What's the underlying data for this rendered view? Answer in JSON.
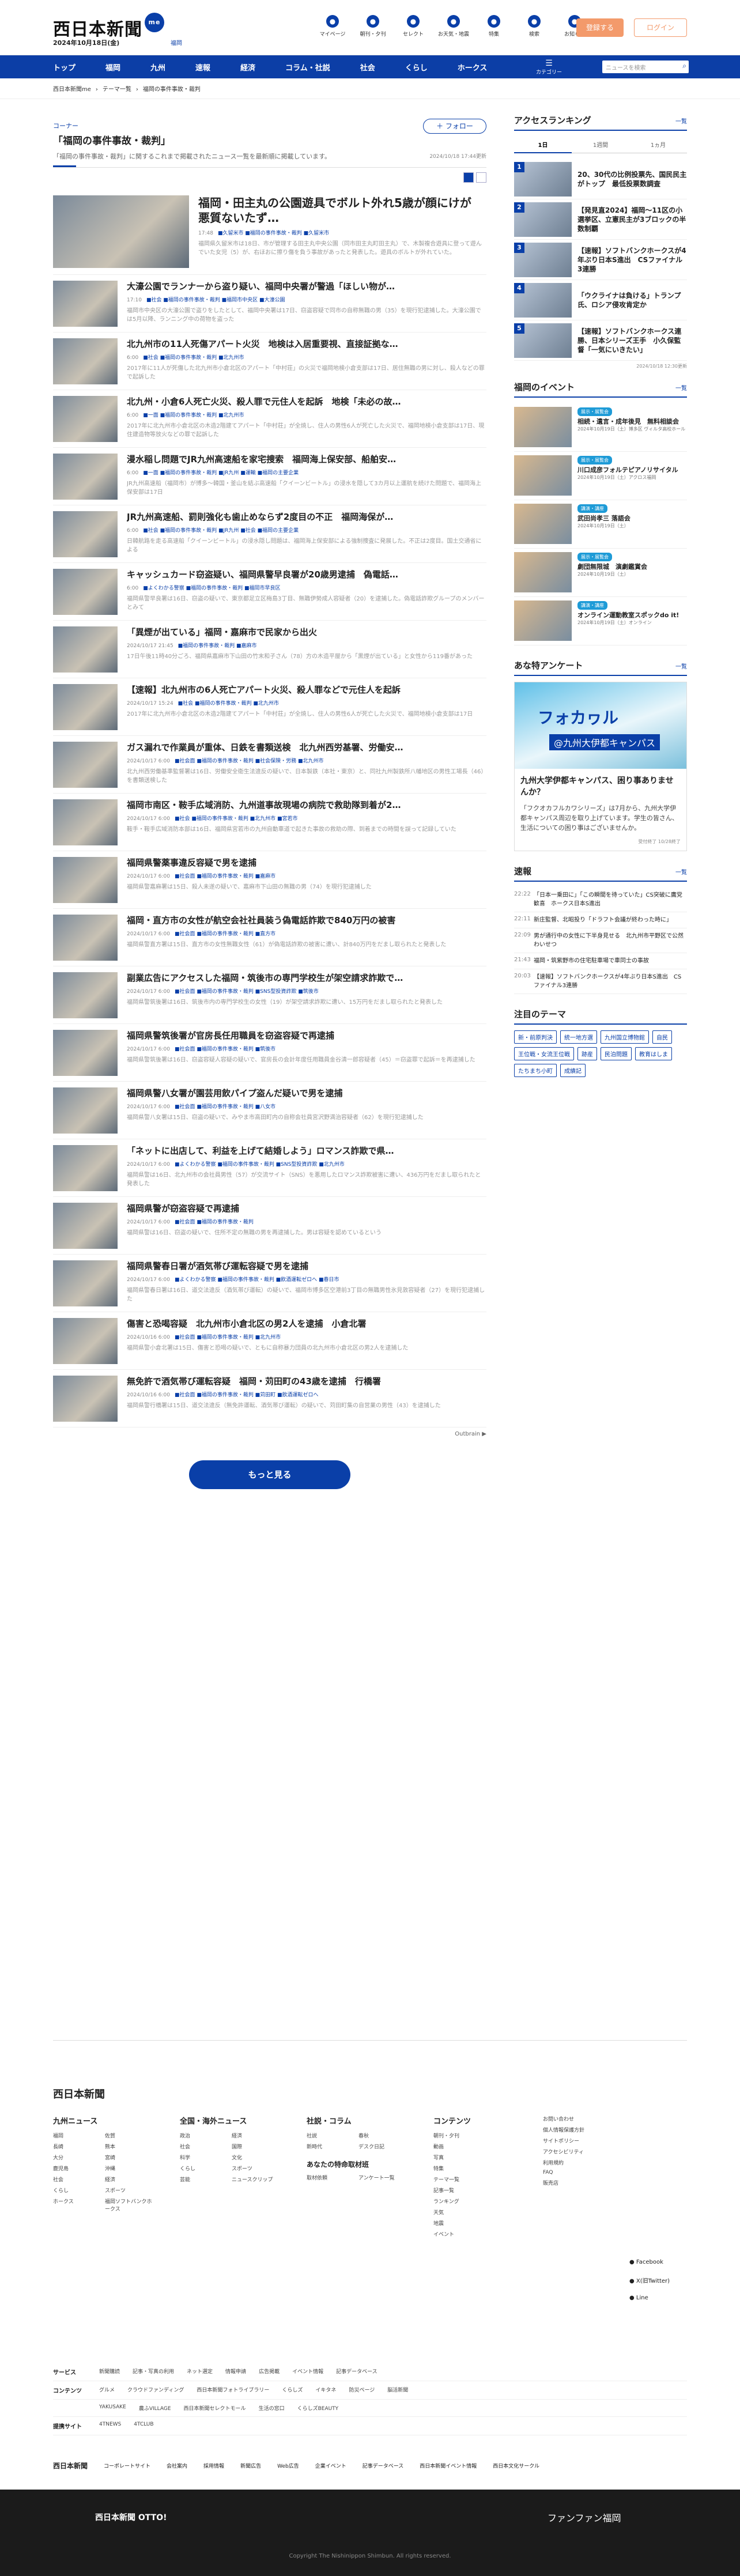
{
  "header": {
    "logo": "西日本新聞",
    "badge": "me",
    "date": "2024年10月18日(金)",
    "area": "福岡",
    "icons": [
      {
        "label": "マイページ",
        "icon": "person-icon"
      },
      {
        "label": "朝刊・夕刊",
        "icon": "paper-icon"
      },
      {
        "label": "セレクト",
        "icon": "select-icon"
      },
      {
        "label": "お天気・地震",
        "icon": "weather-icon"
      },
      {
        "label": "特集",
        "icon": "book-icon"
      },
      {
        "label": "検索",
        "icon": "search-icon"
      },
      {
        "label": "お知らせ",
        "icon": "bell-icon"
      }
    ],
    "register": "登録する",
    "login": "ログイン"
  },
  "nav": {
    "items": [
      "トップ",
      "福岡",
      "九州",
      "速報",
      "経済",
      "コラム・社説",
      "社会",
      "くらし",
      "ホークス"
    ],
    "menu": "カテゴリー",
    "search_placeholder": "ニュースを検索"
  },
  "breadcrumb": [
    "西日本新聞me",
    "テーマ一覧",
    "福岡の事件事故・裁判"
  ],
  "page": {
    "corner": "コーナー",
    "title": "「福岡の事件事故・裁判」",
    "desc": "「福岡の事件事故・裁判」に関するこれまで掲載されたニュース一覧を最新順に掲載しています。",
    "follow": "＋ フォロー",
    "updated": "2024/10/18 17:44更新"
  },
  "articles": [
    {
      "t": "福岡・田主丸の公園遊具でボルト外れ5歳が顔にけが　悪質ないたず…",
      "tm": "17:48",
      "tags": "■久留米市 ■福岡の事件事故・裁判 ■久留米市",
      "ex": "福岡県久留米市は18日、市が管理する田主丸中央公園（同市田主丸町田主丸）で、木製複合遊具に登って遊んでいた女児（5）が、右ほおに擦り傷を負う事故があったと発表した。遊具のボルトが外れていた。"
    },
    {
      "t": "大濠公園でランナーから盗り疑い、福岡中央署が警過「ほしい物が…",
      "tm": "17:10",
      "tags": "■社会 ■福岡の事件事故・裁判 ■福岡市中央区 ■大濠公園",
      "ex": "福岡市中央区の大濠公園で盗りをしたとして、福岡中央署は17日、窃盗容疑で同市の自称無職の男（35）を現行犯逮捕した。大濠公園では5月以降、ランニング中の荷物を盗った"
    },
    {
      "t": "北九州市の11人死傷アパート火災　地検は入居重要視、直接証拠な…",
      "tm": "6:00",
      "tags": "■社会 ■福岡の事件事故・裁判 ■北九州市",
      "ex": "2017年に11人が死傷した北九州市小倉北区のアパート「中村荘」の火災で福岡地検小倉支部は17日、居住無職の男に対し、殺人などの罪で起訴した"
    },
    {
      "t": "北九州・小倉6人死亡火災、殺人罪で元住人を起訴　地検「未必の故…",
      "tm": "6:00",
      "tags": "■一面 ■福岡の事件事故・裁判 ■北九州市",
      "ex": "2017年に北九州市小倉北区の木造2階建てアパート「中村荘」が全焼し、住人の男性6人が死亡した火災で、福岡地検小倉支部は17日、現住建造物等放火などの罪で起訴した"
    },
    {
      "t": "漫水稲し問題でJR九州高速船を家宅捜索　福岡海上保安部、船舶安…",
      "tm": "6:00",
      "tags": "■一面 ■福岡の事件事故・裁判 ■JR九州 ■運輸 ■福岡の主要企業",
      "ex": "JR九州高速船（福岡市）が博多～韓国・釜山を結ぶ高速船「クイーンビートル」の浸水を隠して3カ月以上運航を続けた問題で、福岡海上保安部は17日"
    },
    {
      "t": "JR九州高速船、罰則強化も歯止めならず2度目の不正　福岡海保が…",
      "tm": "6:00",
      "tags": "■社会 ■福岡の事件事故・裁判 ■JR九州 ■社会 ■福岡の主要企業",
      "ex": "日韓航路を走る高速船「クイーンビートル」の浸水隠し問題は、福岡海上保安部による強制捜査に発展した。不正は2度目。国土交通省による"
    },
    {
      "t": "キャッシュカード窃盗疑い、福岡県警早良署が20歳男逮捕　偽電話…",
      "tm": "6:00",
      "tags": "■よくわかる警察 ■福岡の事件事故・裁判 ■福岡市早良区",
      "ex": "福岡県警早良署は16日、窃盗の疑いで、東京都足立区梅島3丁目、無職伊勢成人容疑者（20）を逮捕した。偽電話詐欺グループのメンバーとみて"
    },
    {
      "t": "「異煙が出ている」福岡・嘉麻市で民家から出火",
      "tm": "2024/10/17 21:45",
      "tags": "■福岡の事件事故・裁判 ■嘉麻市",
      "ex": "17日午後11時40分ごろ、福岡県嘉麻市下山田の竹末和子さん（78）方の木造平屋から「黒煙が出ている」と女性から119番があった"
    },
    {
      "t": "【速報】北九州市の6人死亡アパート火災、殺人罪などで元住人を起訴",
      "tm": "2024/10/17 15:24",
      "tags": "■社会 ■福岡の事件事故・裁判 ■北九州市",
      "ex": "2017年に北九州市小倉北区の木造2階建てアパート「中村荘」が全焼し、住人の男性6人が死亡した火災で、福岡地検小倉支部は17日"
    },
    {
      "t": "ガス漏れで作業員が重体、日鉄を書類送検　北九州西労基署、労働安…",
      "tm": "2024/10/17 6:00",
      "tags": "■社会面 ■福岡の事件事故・裁判 ■社会保険・労務 ■北九州市",
      "ex": "北九州西労働基準監督署は16日、労働安全衛生法違反の疑いで、日本製鉄（本社・東京）と、同社九州製鉄所八幡地区の男性工場長（46）を書類送検した"
    },
    {
      "t": "福岡市南区・鞍手広域消防、九州道事故現場の病院で救助隊到着が2…",
      "tm": "2024/10/17 6:00",
      "tags": "■社会 ■福岡の事件事故・裁判 ■北九州市 ■宮若市",
      "ex": "鞍手・鞍手広域消防本部は16日、福岡県宮若市の九州自動車道で起きた事故の救助の際、到着までの時間を誤って記録していた"
    },
    {
      "t": "福岡県警薬事違反容疑で男を逮捕",
      "tm": "2024/10/17 6:00",
      "tags": "■社会面 ■福岡の事件事故・裁判 ■嘉麻市",
      "ex": "福岡県警嘉麻署は15日、殺人未遂の疑いで、嘉麻市下山田の無職の男（74）を現行犯逮捕した"
    },
    {
      "t": "福岡・直方市の女性が航空会社社員装う偽電話詐欺で840万円の被害",
      "tm": "2024/10/17 6:00",
      "tags": "■社会面 ■福岡の事件事故・裁判 ■直方市",
      "ex": "福岡県警直方署は15日、直方市の女性無職女性（61）が偽電話詐欺の被害に遭い、計840万円をだまし取られたと発表した"
    },
    {
      "t": "副業広告にアクセスした福岡・筑後市の専門学校生が架空請求詐欺で…",
      "tm": "2024/10/17 6:00",
      "tags": "■社会面 ■福岡の事件事故・裁判 ■SNS型投資詐欺 ■筑後市",
      "ex": "福岡県警筑後署は16日、筑後市内の専門学校生の女性（19）が架空請求詐欺に遭い、15万円をだまし取られたと発表した"
    },
    {
      "t": "福岡県警筑後署が官房長任用職員を窃盗容疑で再逮捕",
      "tm": "2024/10/17 6:00",
      "tags": "■社会面 ■福岡の事件事故・裁判 ■筑後市",
      "ex": "福岡県警筑後署は16日、窃盗容疑人容疑の疑いで、官房長の会計年度任用職員金谷清一郎容疑者（45）＝窃盗罪で起訴＝を再逮捕した"
    },
    {
      "t": "福岡県警八女署が園芸用飲パイプ盗んだ疑いで男を逮捕",
      "tm": "2024/10/17 6:00",
      "tags": "■社会面 ■福岡の事件事故・裁判 ■八女市",
      "ex": "福岡県警八女署は15日、窃盗の疑いで、みやま市高田町内の自称会社員宮沢野満治容疑者（62）を現行犯逮捕した"
    },
    {
      "t": "「ネットに出店して、利益を上げて結婚しよう」ロマンス詐欺で県…",
      "tm": "2024/10/17 6:00",
      "tags": "■よくわかる警察 ■福岡の事件事故・裁判 ■SNS型投資詐欺 ■北九州市",
      "ex": "福岡県警は16日、北九州市の会社員男性（57）が交流サイト（SNS）を悪用したロマンス詐欺被害に遭い、436万円をだまし取られたと発表した"
    },
    {
      "t": "福岡県警が窃盗容疑で再逮捕",
      "tm": "2024/10/17 6:00",
      "tags": "■社会面 ■福岡の事件事故・裁判",
      "ex": "福岡県警は16日、窃盗の疑いで、住所不定の無職の男を再逮捕した。男は容疑を認めているという"
    },
    {
      "t": "福岡県警春日署が酒気帯び運転容疑で男を逮捕",
      "tm": "2024/10/17 6:00",
      "tags": "■よくわかる警察 ■福岡の事件事故・裁判 ■飲酒運転ゼロへ ■春日市",
      "ex": "福岡県警春日署は16日、道交法違反（酒気帯び運転）の疑いで、福岡市博多区空港前3丁目の無職男性氷見敦容疑者（27）を現行犯逮捕した"
    },
    {
      "t": "傷害と恐喝容疑　北九州市小倉北区の男2人を逮捕　小倉北署",
      "tm": "2024/10/16 6:00",
      "tags": "■社会面 ■福岡の事件事故・裁判 ■北九州市",
      "ex": "福岡県警小倉北署は15日、傷害と恐喝の疑いで、ともに自称暴力団員の北九州市小倉北区の男2人を逮捕した"
    },
    {
      "t": "無免許で酒気帯び運転容疑　福岡・苅田町の43歳を逮捕　行橋署",
      "tm": "2024/10/16 6:00",
      "tags": "■社会面 ■福岡の事件事故・裁判 ■苅田町 ■飲酒運転ゼロへ",
      "ex": "福岡県警行橋署は15日、道交法違反（無免許運転、酒気帯び運転）の疑いで、苅田町集の自営業の男性（43）を逮捕した"
    }
  ],
  "outbrain": "Outbrain ▶",
  "more": "もっと見る",
  "ranking": {
    "title": "アクセスランキング",
    "more": "一覧",
    "tabs": [
      "1日",
      "1週間",
      "1ヵ月"
    ],
    "items": [
      "20、30代の比例投票先、国民民主がトップ　最低投票数調査",
      "【発見直2024】福岡〜11区の小選挙区、立憲民主が3ブロックの半数制覇",
      "【速報】ソフトバンクホークスが4年ぶり日本S進出　CSファイナル3連勝",
      "「ウクライナは負ける」トランプ氏、ロシア侵攻肯定か",
      "【速報】ソフトバンクホークス連勝、日本シリーズ王手　小久保監督「一気にいきたい」"
    ],
    "updated": "2024/10/18 12:30更新"
  },
  "events": {
    "title": "福岡のイベント",
    "more": "一覧",
    "items": [
      {
        "tag": "展示・展覧会",
        "t": "相続・遺言・成年後見　無料相談会",
        "d": "2024年10月19日（土）博多区 ヴィルタ高校ホール"
      },
      {
        "tag": "展示・展覧会",
        "t": "川口成彦フォルテピアノリサイタル",
        "d": "2024年10月19日（土）アクロス福岡"
      },
      {
        "tag": "講演・講座",
        "t": "武田尚孝三 落語会",
        "d": "2024年10月19日（土）"
      },
      {
        "tag": "展示・展覧会",
        "t": "劇団無限城　演劇鑑賞会",
        "d": "2024年10月19日（土）"
      },
      {
        "tag": "講演・講座",
        "t": "オンライン運動教室スポックdo it!",
        "d": "2024年10月19日（土）オンライン"
      }
    ]
  },
  "enquete": {
    "title": "あな特アンケート",
    "more": "一覧",
    "img_label": "フォカヮル",
    "img_sub": "@九州大伊都キャンパス",
    "t": "九州大学伊都キャンパス、困り事ありませんか？",
    "d": "「フクオカフルカワシリーズ」は7月から、九州大学伊都キャンパス周辺を取り上げています。学生の皆さん、生活についての困り事はございませんか。",
    "dt": "受付終了 10/28終了"
  },
  "sokuho": {
    "title": "速報",
    "more": "一覧",
    "items": [
      {
        "tm": "22:22",
        "t": "「日本一乗田に」「この瞬間を待っていた」CS突破に鷹党歓喜　ホークス日本S進出"
      },
      {
        "tm": "22:11",
        "t": "新庄監督、北昭投り「ドラフト会議が終わった時に」"
      },
      {
        "tm": "22:09",
        "t": "男が通行中の女性に下半身見せる　北九州市平野区で公然わいせつ"
      },
      {
        "tm": "21:43",
        "t": "福岡・筑紫野市の住宅駐車場で車同士の事故"
      },
      {
        "tm": "20:03",
        "t": "【速報】ソフトバンクホークスが4年ぶり日本S進出　CSファイナル3連勝"
      }
    ]
  },
  "themes": {
    "title": "注目のテーマ",
    "items": [
      "新・前原判決",
      "統一地方選",
      "九州国立博物館",
      "自民",
      "王位戦・女流王位戦",
      "跡産",
      "民泊問題",
      "教育はしま",
      "たちまち小町",
      "成績記"
    ]
  },
  "footer": {
    "logo": "西日本新聞",
    "cols": [
      {
        "h": "九州ニュース",
        "items": [
          "福岡",
          "佐賀",
          "長崎",
          "熊本",
          "大分",
          "宮崎",
          "鹿児島",
          "沖縄",
          "社会",
          "経済",
          "くらし",
          "スポーツ",
          "ホークス",
          "福岡ソフトバンクホークス"
        ]
      },
      {
        "h": "全国・海外ニュース",
        "items": [
          "政治",
          "経済",
          "社会",
          "国際",
          "科学",
          "文化",
          "くらし",
          "スポーツ",
          "芸能",
          "ニュースクリップ"
        ]
      },
      {
        "h": "社説・コラム",
        "items": [
          "社説",
          "春秋",
          "新時代",
          "デスク日記"
        ],
        "h2": "あなたの特命取材班",
        "items2": [
          "取材依頼",
          "アンケート一覧"
        ]
      },
      {
        "h": "コンテンツ",
        "items": [
          "朝刊・夕刊",
          "動画",
          "写真",
          "特集",
          "テーマ一覧",
          "記事一覧",
          "ランキング",
          "天気",
          "地震",
          "イベント"
        ]
      },
      {
        "h": "",
        "items": [
          "お問い合わせ",
          "個人情報保護方針",
          "サイトポリシー",
          "アクセシビリティ",
          "利用規約",
          "FAQ",
          "販売店"
        ]
      }
    ],
    "social": [
      "Facebook",
      "X(旧Twitter)",
      "Line"
    ],
    "links": [
      {
        "h": "サービス",
        "items": [
          "新聞購読",
          "記事・写真の利用",
          "ネット選定",
          "情報申請",
          "広告掲載",
          "イベント情報",
          "記事データベース"
        ]
      },
      {
        "h": "コンテンツ",
        "items": [
          "グルメ",
          "クラウドファンディング",
          "西日本新聞フォトライブラリー",
          "くらしズ",
          "イキタネ",
          "防災ページ",
          "脳活新聞"
        ]
      },
      {
        "h": "",
        "items": [
          "YAKUSAKE",
          "農ふVILLAGE",
          "西日本新聞セレクトモール",
          "生活の窓口",
          "くらしズBEAUTY"
        ]
      },
      {
        "h": "提携サイト",
        "items": [
          "4TNEWS",
          "4TCLUB"
        ]
      }
    ],
    "corp": {
      "name": "西日本新聞",
      "items": [
        "コーポレートサイト",
        "会社案内",
        "採用情報",
        "新聞広告",
        "Web広告",
        "企業イベント",
        "記事データベース",
        "西日本新聞イベント情報",
        "西日本文化サークル"
      ]
    },
    "otto": "西日本新聞 OTTO!",
    "fan": "ファンファン福岡",
    "copyright": "Copyright The Nishinippon Shimbun. All rights reserved."
  }
}
